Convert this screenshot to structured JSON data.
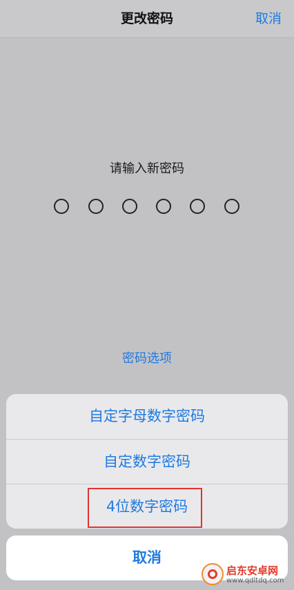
{
  "nav": {
    "title": "更改密码",
    "cancel_label": "取消"
  },
  "passcode": {
    "prompt": "请输入新密码",
    "dot_count": 6,
    "entered": 0
  },
  "options_link": "密码选项",
  "action_sheet": {
    "items": [
      {
        "label": "自定字母数字密码"
      },
      {
        "label": "自定数字密码"
      },
      {
        "label": "4位数字密码"
      }
    ],
    "highlighted_index": 2,
    "cancel_label": "取消"
  },
  "watermark": {
    "title": "启东安卓网",
    "url": "www.qdltdq.com"
  },
  "colors": {
    "accent": "#1f7ae0",
    "highlight": "#e2322d",
    "dim_background": "#c2c2c5",
    "sheet_background": "#e9e9ec"
  }
}
